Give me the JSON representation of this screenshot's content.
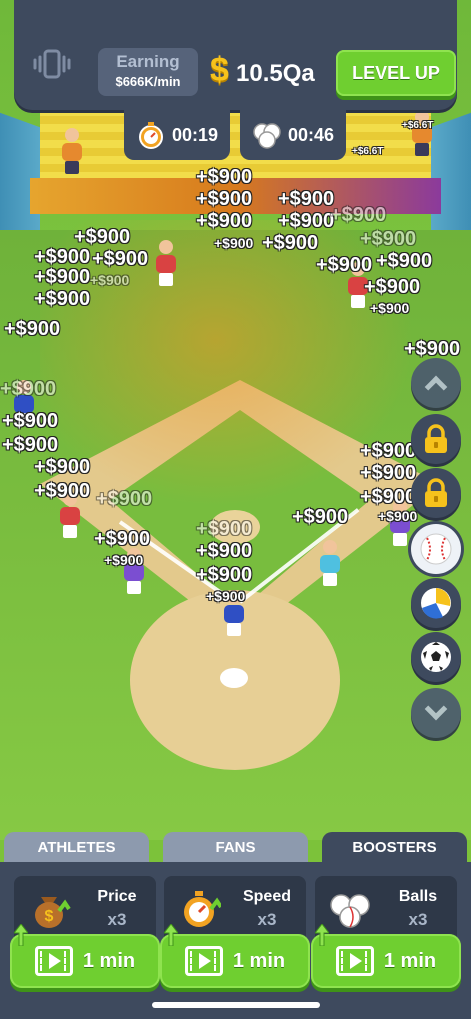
{
  "hud": {
    "earning_title": "Earning",
    "earning_rate": "$666K/min",
    "currency_symbol": "$",
    "balance": "10.5Qa",
    "level_up_label": "LEVEL UP"
  },
  "timers": [
    {
      "icon": "stopwatch-icon",
      "value": "00:19"
    },
    {
      "icon": "balls-icon",
      "value": "00:46"
    }
  ],
  "floating_money": {
    "big": "+$900",
    "bleacher_1": "+$6.6T",
    "bleacher_2": "+$6.6T"
  },
  "side_controls": [
    {
      "name": "scroll-up-button",
      "icon": "chevron-up-icon"
    },
    {
      "name": "locked-slot-1",
      "icon": "lock-icon"
    },
    {
      "name": "locked-slot-2",
      "icon": "lock-icon"
    },
    {
      "name": "sport-baseball-button",
      "icon": "baseball-icon",
      "selected": true
    },
    {
      "name": "sport-volleyball-button",
      "icon": "volleyball-icon"
    },
    {
      "name": "sport-soccer-button",
      "icon": "soccer-ball-icon"
    },
    {
      "name": "scroll-down-button",
      "icon": "chevron-down-icon"
    }
  ],
  "tabs": [
    {
      "label": "ATHLETES",
      "active": false
    },
    {
      "label": "FANS",
      "active": false
    },
    {
      "label": "BOOSTERS",
      "active": true
    }
  ],
  "boosters": [
    {
      "name": "Price",
      "multiplier": "x3",
      "icon": "money-bag-icon",
      "button_label": "1 min"
    },
    {
      "name": "Speed",
      "multiplier": "x3",
      "icon": "stopwatch-icon",
      "button_label": "1 min"
    },
    {
      "name": "Balls",
      "multiplier": "x3",
      "icon": "balls-icon",
      "button_label": "1 min"
    }
  ],
  "colors": {
    "panel": "#3e4a5e",
    "accent_green": "#6fcf30",
    "coin_gold": "#f6c21c",
    "grass": "#7fc63f",
    "dirt": "#e3c98c"
  }
}
